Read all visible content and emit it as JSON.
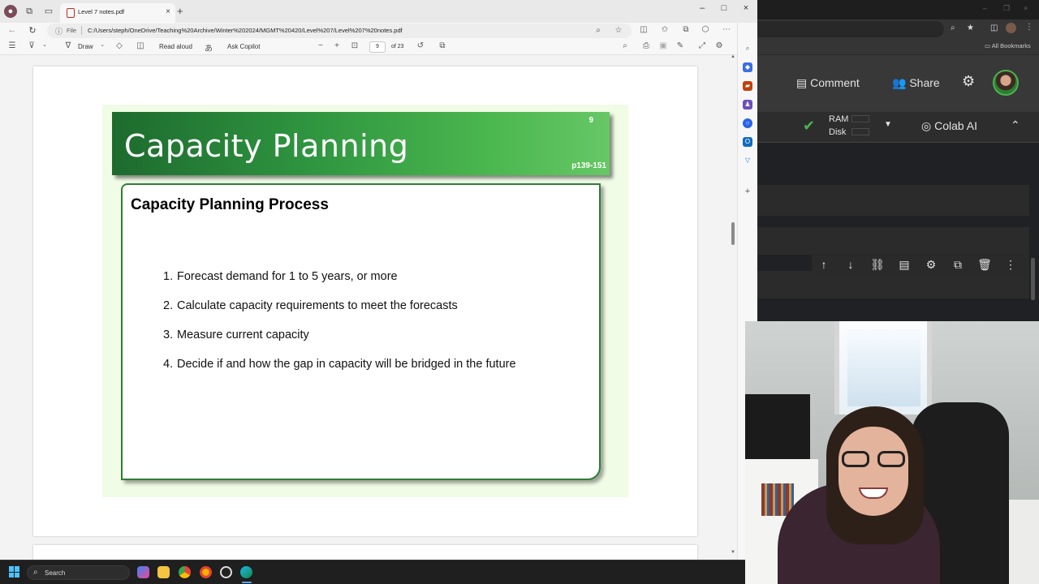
{
  "edge": {
    "tab_title": "Level 7 notes.pdf",
    "tab_close": "×",
    "new_tab": "+",
    "window_controls": [
      "–",
      "□",
      "×"
    ],
    "address": {
      "file_label": "File",
      "url": "C:/Users/steph/OneDrive/Teaching%20Archive/Winter%202024/MGMT%20420/Level%207/Level%207%20notes.pdf"
    },
    "pdf_toolbar": {
      "draw": "Draw",
      "read_aloud": "Read aloud",
      "ask_copilot": "Ask Copilot",
      "minus": "−",
      "plus": "+",
      "page_current": "9",
      "page_total": "of 23"
    }
  },
  "slide": {
    "title": "Capacity Planning",
    "number": "9",
    "pages": "p139-151",
    "heading": "Capacity Planning Process",
    "steps": [
      {
        "n": "1.",
        "text": "Forecast demand for 1 to 5 years, or more"
      },
      {
        "n": "2.",
        "text": "Calculate capacity requirements to meet the forecasts"
      },
      {
        "n": "3.",
        "text": "Measure current capacity"
      },
      {
        "n": "4.",
        "text": "Decide if and how the gap in capacity will be bridged in the future"
      }
    ]
  },
  "colab": {
    "bookmarks": "All Bookmarks",
    "comment": "Comment",
    "share": "Share",
    "ram": "RAM",
    "disk": "Disk",
    "colab_ai": "Colab AI"
  },
  "taskbar": {
    "search": "Search"
  },
  "colors": {
    "slide_green_dark": "#1d6b2e",
    "slide_green_light": "#66c766",
    "edge_accent": "#0078d4",
    "colab_check": "#4caf50"
  }
}
